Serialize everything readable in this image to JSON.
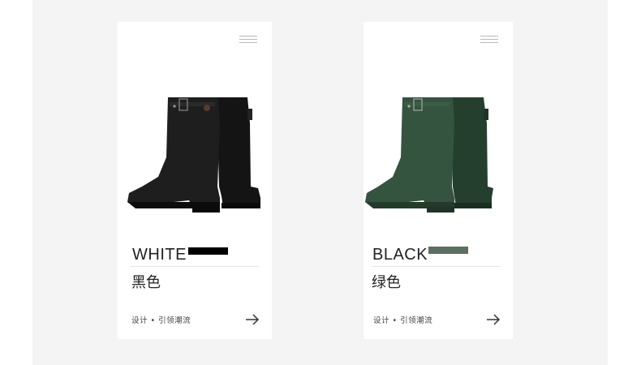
{
  "cards": [
    {
      "name": "WHITE",
      "subtitle": "黑色",
      "tagline": "设计 • 引领潮流",
      "swatch_color": "#000000",
      "boot_color": "#1b1b1b",
      "menu_icon": "hamburger-menu-icon",
      "action_icon": "arrow-right-icon"
    },
    {
      "name": "BLACK",
      "subtitle": "绿色",
      "tagline": "设计 • 引领潮流",
      "swatch_color": "#5c6f60",
      "boot_color": "#2e4a38",
      "menu_icon": "hamburger-menu-icon",
      "action_icon": "arrow-right-icon"
    }
  ],
  "colors": {
    "page_background": "#ffffff",
    "panel_background": "#f4f4f4",
    "card_background": "#ffffff"
  }
}
